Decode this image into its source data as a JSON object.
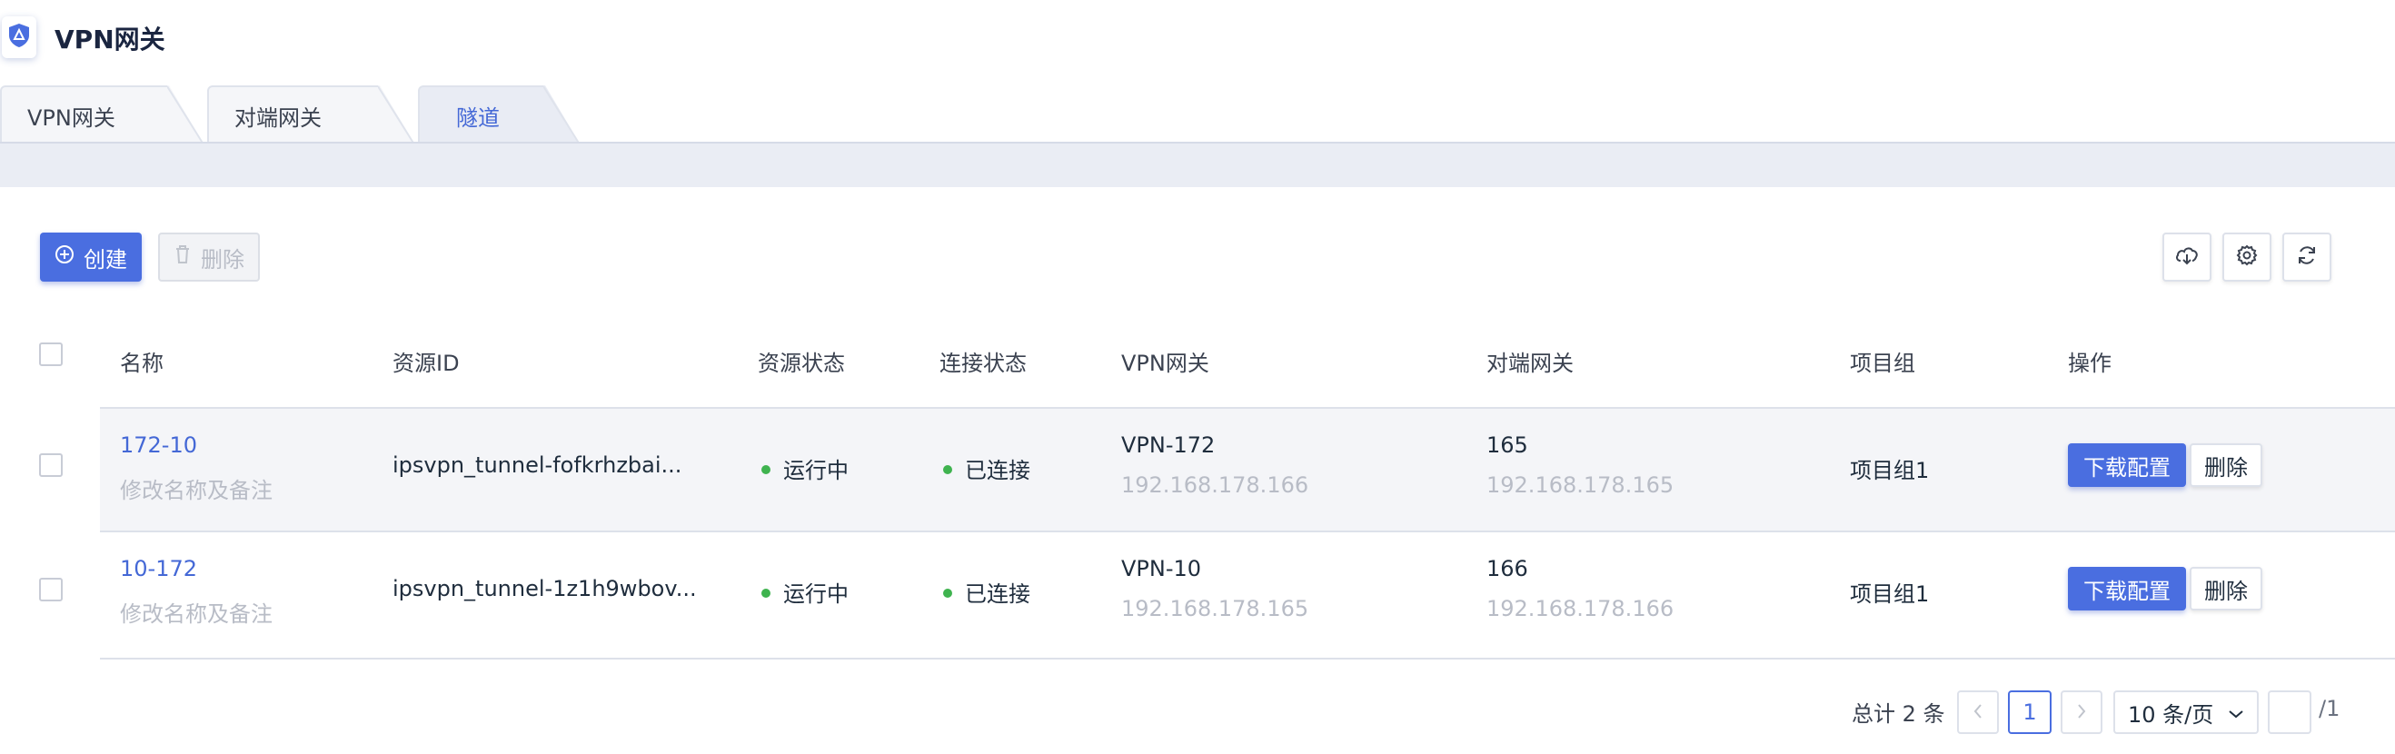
{
  "app": {
    "title": "VPN网关"
  },
  "tabs": [
    {
      "label": "VPN网关"
    },
    {
      "label": "对端网关"
    },
    {
      "label": "隧道"
    }
  ],
  "toolbar": {
    "create_label": "创建",
    "delete_label": "删除",
    "icons": [
      "cloud-download-icon",
      "settings-icon",
      "refresh-icon"
    ]
  },
  "table": {
    "columns": [
      "名称",
      "资源ID",
      "资源状态",
      "连接状态",
      "VPN网关",
      "对端网关",
      "项目组",
      "操作"
    ],
    "rows": [
      {
        "name": "172-10",
        "name_hint": "修改名称及备注",
        "resource_id": "ipsvpn_tunnel-fofkrhzbai...",
        "resource_status": "运行中",
        "connection_status": "已连接",
        "vpn_gateway": "VPN-172",
        "vpn_gateway_ip": "192.168.178.166",
        "peer_gateway": "165",
        "peer_gateway_ip": "192.168.178.165",
        "project": "项目组1",
        "download_label": "下载配置",
        "delete_label": "删除"
      },
      {
        "name": "10-172",
        "name_hint": "修改名称及备注",
        "resource_id": "ipsvpn_tunnel-1z1h9wbov...",
        "resource_status": "运行中",
        "connection_status": "已连接",
        "vpn_gateway": "VPN-10",
        "vpn_gateway_ip": "192.168.178.165",
        "peer_gateway": "166",
        "peer_gateway_ip": "192.168.178.166",
        "project": "项目组1",
        "download_label": "下载配置",
        "delete_label": "删除"
      }
    ]
  },
  "pagination": {
    "total_label": "总计 2 条",
    "current_page": "1",
    "page_size": "10 条/页",
    "total_pages": "/1"
  },
  "colors": {
    "primary": "#4a6ee0",
    "status_ok": "#3fb34f",
    "link": "#4468d6"
  }
}
